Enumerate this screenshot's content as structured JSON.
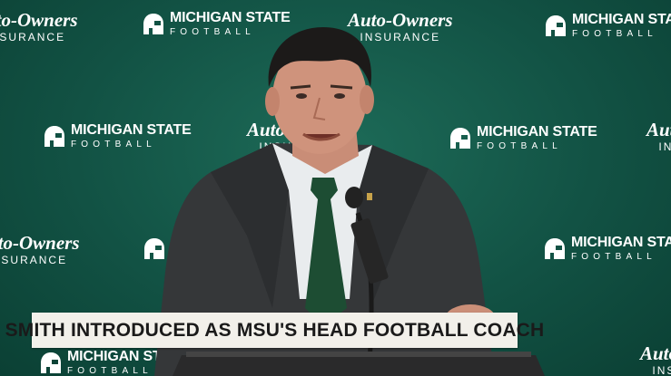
{
  "backdrop": {
    "sponsor_logos": [
      {
        "line1": "Auto-Owners",
        "line2": "INSURANCE"
      },
      {
        "line1": "MICHIGAN STATE",
        "line2": "FOOTBALL"
      }
    ],
    "brand_colors": {
      "green": "#18453b",
      "white": "#ffffff"
    }
  },
  "lower_third": {
    "headline": "SMITH INTRODUCED AS MSU'S HEAD FOOTBALL COACH"
  },
  "subject": {
    "description_icon": "spartan-helmet-icon"
  }
}
